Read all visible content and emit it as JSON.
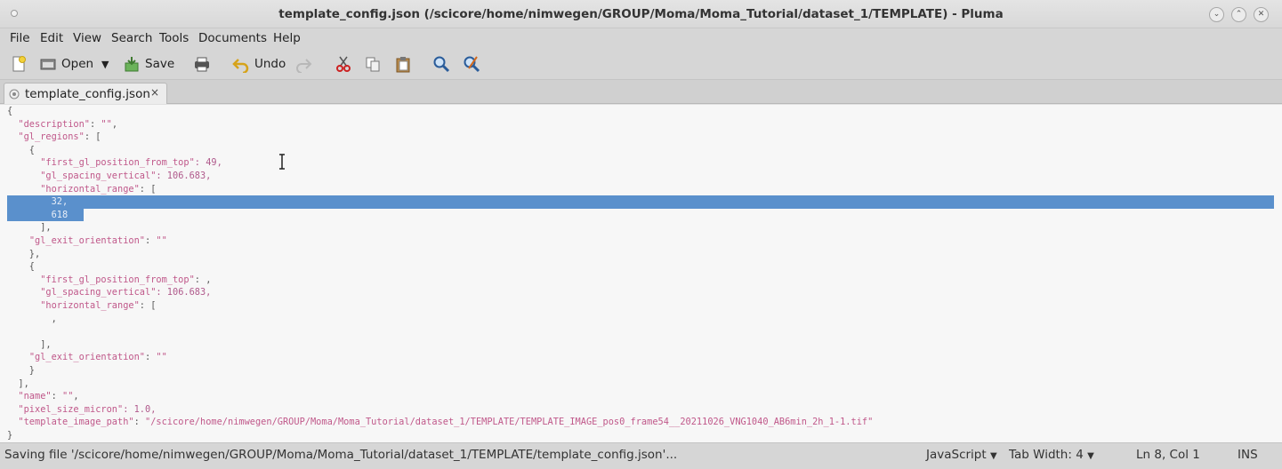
{
  "window": {
    "title": "template_config.json (/scicore/home/nimwegen/GROUP/Moma/Moma_Tutorial/dataset_1/TEMPLATE) - Pluma",
    "minimize_icon": "chevron-down-icon",
    "maximize_icon": "chevron-up-icon",
    "close_icon": "close-icon"
  },
  "menubar": [
    "File",
    "Edit",
    "View",
    "Search",
    "Tools",
    "Documents",
    "Help"
  ],
  "toolbar": {
    "open_label": "Open",
    "save_label": "Save",
    "undo_label": "Undo",
    "dropdown_glyph": "▼"
  },
  "tab": {
    "label": "template_config.json",
    "close_glyph": "×"
  },
  "editor": {
    "lines": [
      "{",
      "  \"description\": \"\",",
      "  \"gl_regions\": [",
      "    {",
      "      \"first_gl_position_from_top\": 49,",
      "      \"gl_spacing_vertical\": 106.683,",
      "      \"horizontal_range\": [",
      "        32,",
      "        618",
      "      ],",
      "    \"gl_exit_orientation\": \"\"",
      "    },",
      "    {",
      "      \"first_gl_position_from_top\": ,",
      "      \"gl_spacing_vertical\": 106.683,",
      "      \"horizontal_range\": [",
      "        ,",
      "",
      "      ],",
      "    \"gl_exit_orientation\": \"\"",
      "    }",
      "  ],",
      "  \"name\": \"\",",
      "  \"pixel_size_micron\": 1.0,",
      "  \"template_image_path\": \"/scicore/home/nimwegen/GROUP/Moma/Moma_Tutorial/dataset_1/TEMPLATE/TEMPLATE_IMAGE_pos0_frame54__20211026_VNG1040_AB6min_2h_1-1.tif\"",
      "}"
    ],
    "selected_lines": [
      7,
      8
    ]
  },
  "statusbar": {
    "message": "Saving file '/scicore/home/nimwegen/GROUP/Moma/Moma_Tutorial/dataset_1/TEMPLATE/template_config.json'...",
    "language": "JavaScript",
    "language_arrow": "▼",
    "tab_width": "Tab Width:  4",
    "tab_width_arrow": "▼",
    "position": "Ln 8, Col 1",
    "mode": "INS"
  },
  "colors": {
    "selection": "#5a90cc",
    "string": "#c0588a",
    "editor_bg": "#f7f7f7"
  }
}
